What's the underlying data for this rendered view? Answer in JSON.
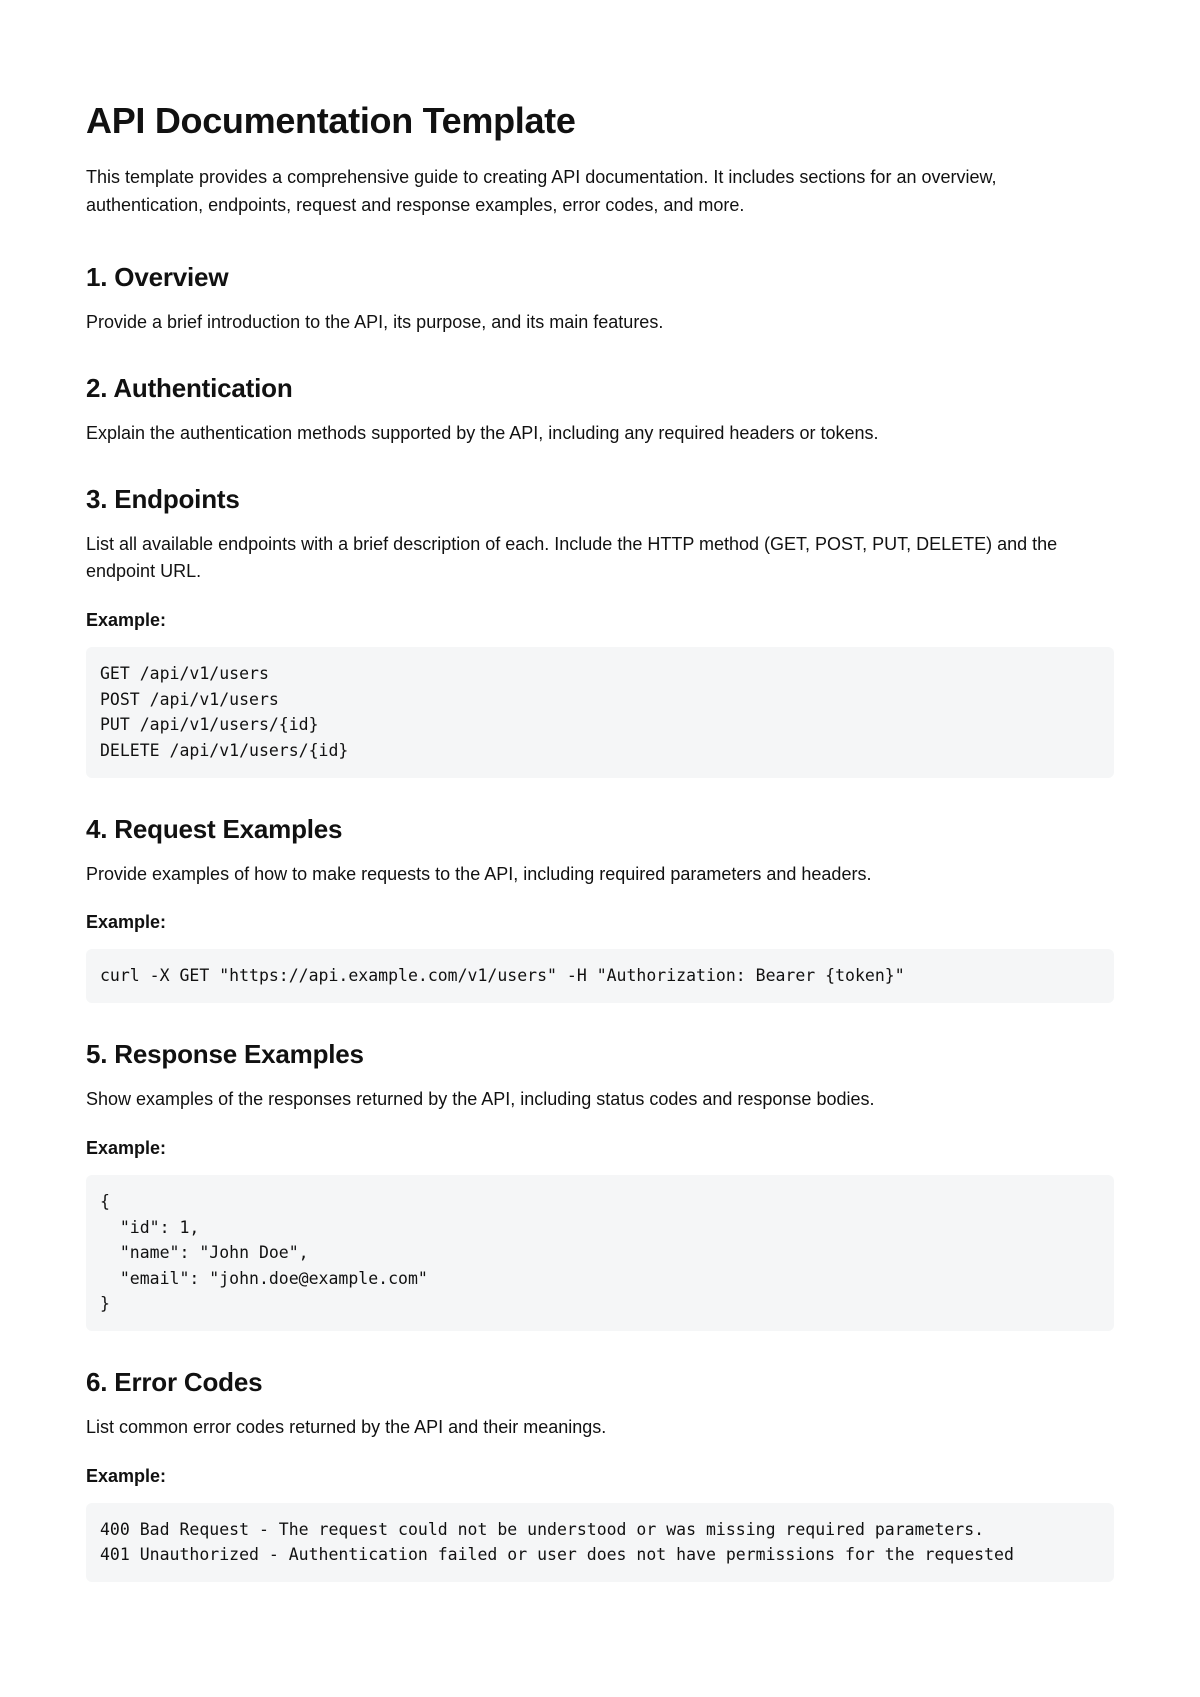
{
  "title": "API Documentation Template",
  "intro": "This template provides a comprehensive guide to creating API documentation. It includes sections for an overview, authentication, endpoints, request and response examples, error codes, and more.",
  "sections": {
    "overview": {
      "heading": "1. Overview",
      "body": "Provide a brief introduction to the API, its purpose, and its main features."
    },
    "authentication": {
      "heading": "2. Authentication",
      "body": "Explain the authentication methods supported by the API, including any required headers or tokens."
    },
    "endpoints": {
      "heading": "3. Endpoints",
      "body": "List all available endpoints with a brief description of each. Include the HTTP method (GET, POST, PUT, DELETE) and the endpoint URL.",
      "example_label": "Example:",
      "example_code": "GET /api/v1/users\nPOST /api/v1/users\nPUT /api/v1/users/{id}\nDELETE /api/v1/users/{id}"
    },
    "request_examples": {
      "heading": "4. Request Examples",
      "body": "Provide examples of how to make requests to the API, including required parameters and headers.",
      "example_label": "Example:",
      "example_code": "curl -X GET \"https://api.example.com/v1/users\" -H \"Authorization: Bearer {token}\""
    },
    "response_examples": {
      "heading": "5. Response Examples",
      "body": "Show examples of the responses returned by the API, including status codes and response bodies.",
      "example_label": "Example:",
      "example_code": "{\n  \"id\": 1,\n  \"name\": \"John Doe\",\n  \"email\": \"john.doe@example.com\"\n}"
    },
    "error_codes": {
      "heading": "6. Error Codes",
      "body": "List common error codes returned by the API and their meanings.",
      "example_label": "Example:",
      "example_code": "400 Bad Request - The request could not be understood or was missing required parameters.\n401 Unauthorized - Authentication failed or user does not have permissions for the requested"
    }
  }
}
